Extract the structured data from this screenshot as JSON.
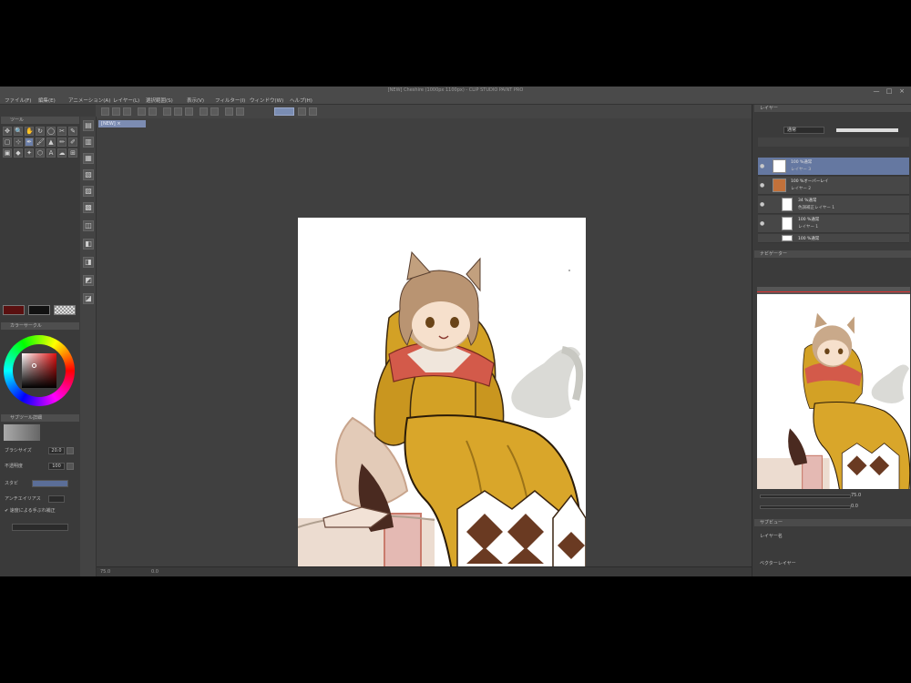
{
  "window": {
    "title": "[NEW] Cheshire (1000px 1100px) - CLIP STUDIO PAINT PRO",
    "controls": [
      "—",
      "□",
      "×"
    ]
  },
  "menu": [
    "ファイル(F)",
    "編集(E)",
    "アニメーション(A)",
    "レイヤー(L)",
    "選択範囲(S)",
    "表示(V)",
    "フィルター(I)",
    "ウィンドウ(W)",
    "ヘルプ(H)"
  ],
  "canvas": {
    "tab_label": "[NEW] ×"
  },
  "left_panels": {
    "tool_header": "ツール",
    "tool_icons": [
      "✥",
      "🔍",
      "✋",
      "↻",
      "◯",
      "✂",
      "✎",
      "▢",
      "⊹",
      "✒",
      "🖌",
      "▲",
      "✏",
      "✐",
      "▣",
      "◆",
      "✦",
      "⬡",
      "A",
      "☁",
      "⊞"
    ],
    "color_header": "カラーサークル",
    "colors": {
      "main": "#5a1010",
      "sub": "#111111",
      "accent": "#e01010"
    },
    "subtool_header": "サブツール詳細",
    "props": [
      {
        "label": "ブラシサイズ",
        "value": "20.0"
      },
      {
        "label": "不透明度",
        "value": "100"
      },
      {
        "label": "スタビ",
        "value": ""
      },
      {
        "label": "アンチエイリアス",
        "value": ""
      },
      {
        "label": "ベクター吸着",
        "value": ""
      },
      {
        "label": "✔ 速度による手ぶれ補正",
        "value": ""
      }
    ]
  },
  "right_panels": {
    "layer_header": "レイヤー",
    "blend_mode": "通常",
    "layers": [
      {
        "name": "100 %通常",
        "sub": "レイヤー 3"
      },
      {
        "name": "100 %オーバーレイ",
        "sub": "レイヤー 2"
      },
      {
        "name": "34 %通常",
        "sub": "色調補正レイヤー 1"
      },
      {
        "name": "100 %通常",
        "sub": "レイヤー 1"
      },
      {
        "name": "100 %通常",
        "sub": "用紙"
      }
    ],
    "navigator_header": "ナビゲーター",
    "nav_values": [
      "75.0",
      "0.0"
    ],
    "info_header": "サブビュー",
    "info_lines": [
      "レイヤー名",
      "ベクターレイヤー"
    ]
  },
  "status": {
    "zoom": "75.0",
    "angle": "0.0"
  }
}
